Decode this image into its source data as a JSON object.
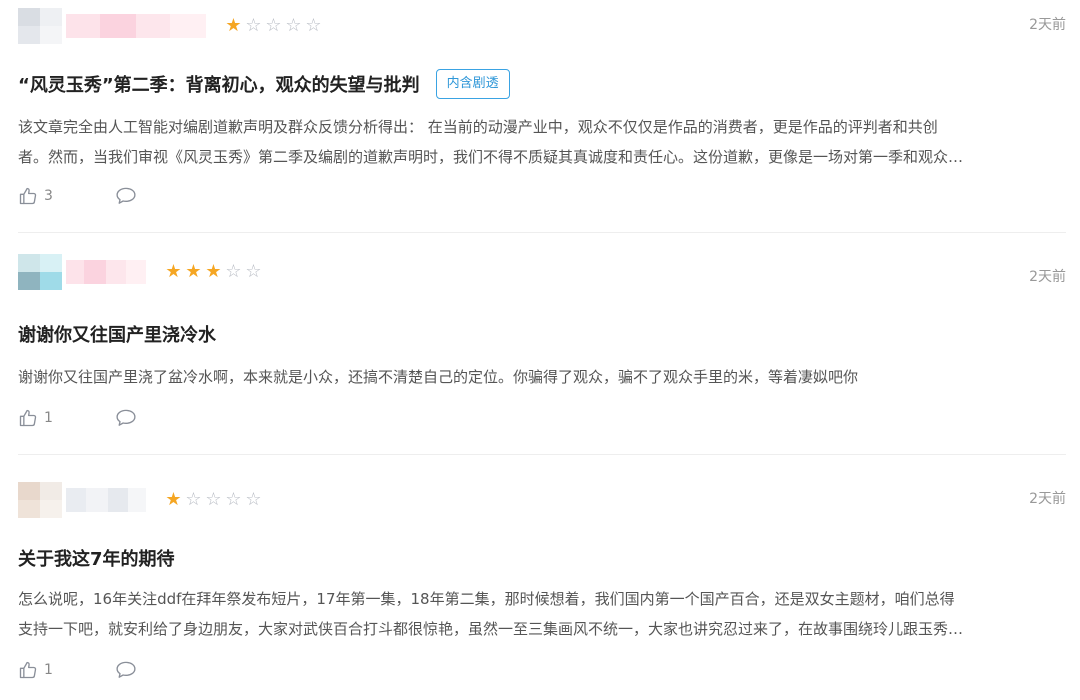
{
  "reviews": [
    {
      "time": "2天前",
      "rating": 1,
      "title": "“风灵玉秀”第二季：背离初心，观众的失望与批判",
      "spoiler_tag": "内含剧透",
      "body": [
        "该文章完全由人工智能对编剧道歉声明及群众反馈分析得出： 在当前的动漫产业中，观众不仅仅是作品的消费者，更是作品的评判者和共创",
        "者。然而，当我们审视《风灵玉秀》第二季及编剧的道歉声明时，我们不得不质疑其真诚度和责任心。这份道歉，更像是一场对第一季和观众…"
      ],
      "likes": "3",
      "avatar_colors": [
        "#d9dde3",
        "#eef0f3",
        "#e4e7ec",
        "#f4f5f7"
      ],
      "name_colors": [
        "#fde3ea",
        "#fbd3df",
        "#fde6ec",
        "#fff0f3"
      ]
    },
    {
      "time": "2天前",
      "rating": 3,
      "title": "谢谢你又往国产里浇冷水",
      "spoiler_tag": "",
      "body": [
        "谢谢你又往国产里浇了盆冷水啊，本来就是小众，还搞不清楚自己的定位。你骗得了观众，骗不了观众手里的米，等着凄姒吧你"
      ],
      "likes": "1",
      "avatar_colors": [
        "#cfe6ea",
        "#d8f1f5",
        "#8fb4bf",
        "#9fdbe8"
      ],
      "name_colors": [
        "#fde3ea",
        "#fbd3df",
        "#fde6ec",
        "#fff0f3"
      ]
    },
    {
      "time": "2天前",
      "rating": 1,
      "title": "关于我这7年的期待",
      "spoiler_tag": "",
      "body": [
        "怎么说呢，16年关注ddf在拜年祭发布短片，17年第一集，18年第二集，那时候想着，我们国内第一个国产百合，还是双女主题材，咱们总得",
        "支持一下吧，就安利给了身边朋友，大家对武侠百合打斗都很惊艳，虽然一至三集画风不统一，大家也讲究忍过来了，在故事围绕玲儿跟玉秀…"
      ],
      "likes": "1",
      "avatar_colors": [
        "#e8d8cc",
        "#f1ebe6",
        "#efe3d9",
        "#f6f1ec"
      ],
      "name_colors": [
        "#e9ecf1",
        "#f2f3f6",
        "#e6e9ee",
        "#f5f6f8"
      ]
    }
  ],
  "colors": {
    "star_filled": "#f5a623",
    "star_empty": "#b8bcc4",
    "tag_border": "#3aa3e3"
  },
  "icons": {
    "like": "thumbs-up-icon",
    "comment": "comment-icon",
    "star": "star-icon"
  }
}
